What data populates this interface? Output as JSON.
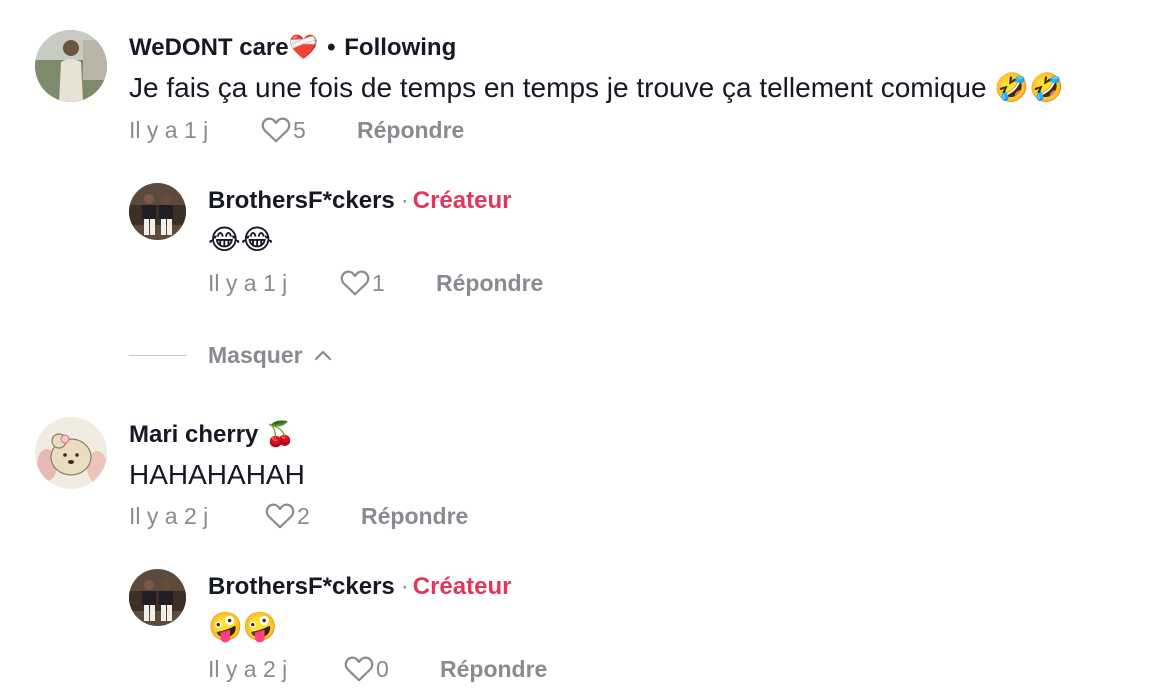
{
  "comments": [
    {
      "username": "WeDONT care❤️‍🩹",
      "following_label": "Following",
      "text": "Je fais ça une fois de temps en temps je trouve ça tellement comique 🤣🤣",
      "time": "Il y a 1 j",
      "likes": "5",
      "reply_label": "Répondre",
      "avatar_icon": "user-photo",
      "replies": [
        {
          "username": "BrothersF*ckers",
          "badge": "Créateur",
          "text": "😂😂",
          "time": "Il y a 1 j",
          "likes": "1",
          "reply_label": "Répondre",
          "avatar_icon": "group-photo"
        }
      ],
      "hide_label": "Masquer"
    },
    {
      "username": "Mari cherry 🍒",
      "text": "HAHAHAHAH",
      "time": "Il y a 2 j",
      "likes": "2",
      "reply_label": "Répondre",
      "avatar_icon": "bear-drawing",
      "replies": [
        {
          "username": "BrothersF*ckers",
          "badge": "Créateur",
          "text": "🤪🤪",
          "time": "Il y a 2 j",
          "likes": "0",
          "reply_label": "Répondre",
          "avatar_icon": "group-photo"
        }
      ]
    }
  ],
  "colors": {
    "primary_text": "#161823",
    "secondary_text": "#8a8b91",
    "creator_badge": "#e0375b"
  }
}
